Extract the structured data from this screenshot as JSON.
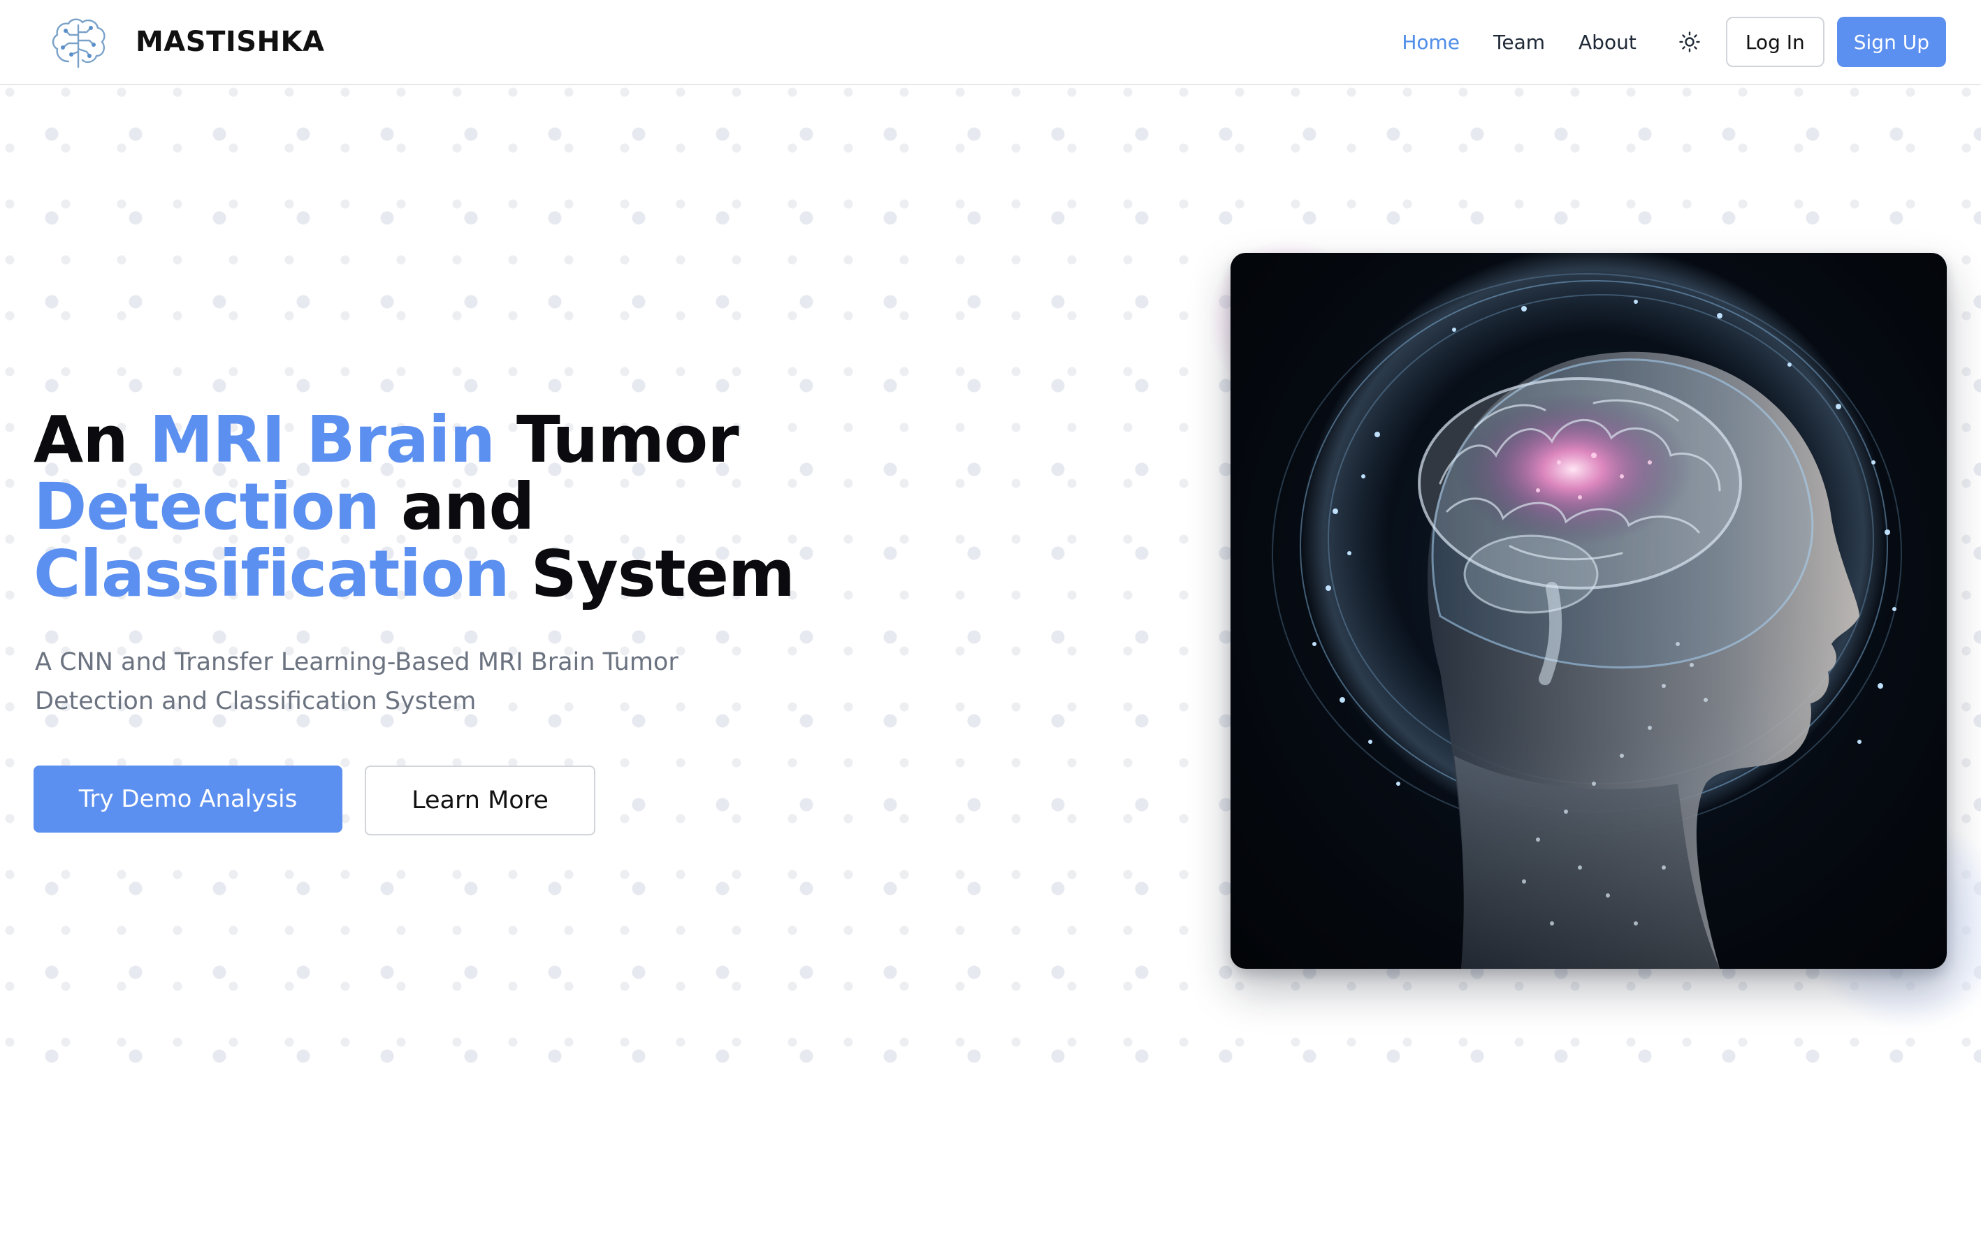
{
  "brand": {
    "name": "MASTISHKA",
    "logo_icon": "brain-circuit-icon"
  },
  "nav": {
    "links": [
      {
        "label": "Home",
        "active": true
      },
      {
        "label": "Team",
        "active": false
      },
      {
        "label": "About",
        "active": false
      }
    ],
    "theme_toggle_icon": "sun-icon",
    "login_label": "Log In",
    "signup_label": "Sign Up"
  },
  "hero": {
    "headline": {
      "part1": "An ",
      "accent1": "MRI Brain",
      "part2": " Tumor",
      "accent2": "Detection",
      "part3": " and",
      "accent3": "Classification",
      "part4": " System"
    },
    "subtitle": "A CNN and Transfer Learning-Based MRI Brain Tumor Detection and Classification System",
    "primary_cta": "Try Demo Analysis",
    "secondary_cta": "Learn More",
    "image_subject": "glowing-brain-head-illustration"
  },
  "colors": {
    "accent": "#5b8ff0",
    "heading": "#0b0b0f",
    "muted_text": "#6b7280",
    "border": "#d1d5db"
  }
}
